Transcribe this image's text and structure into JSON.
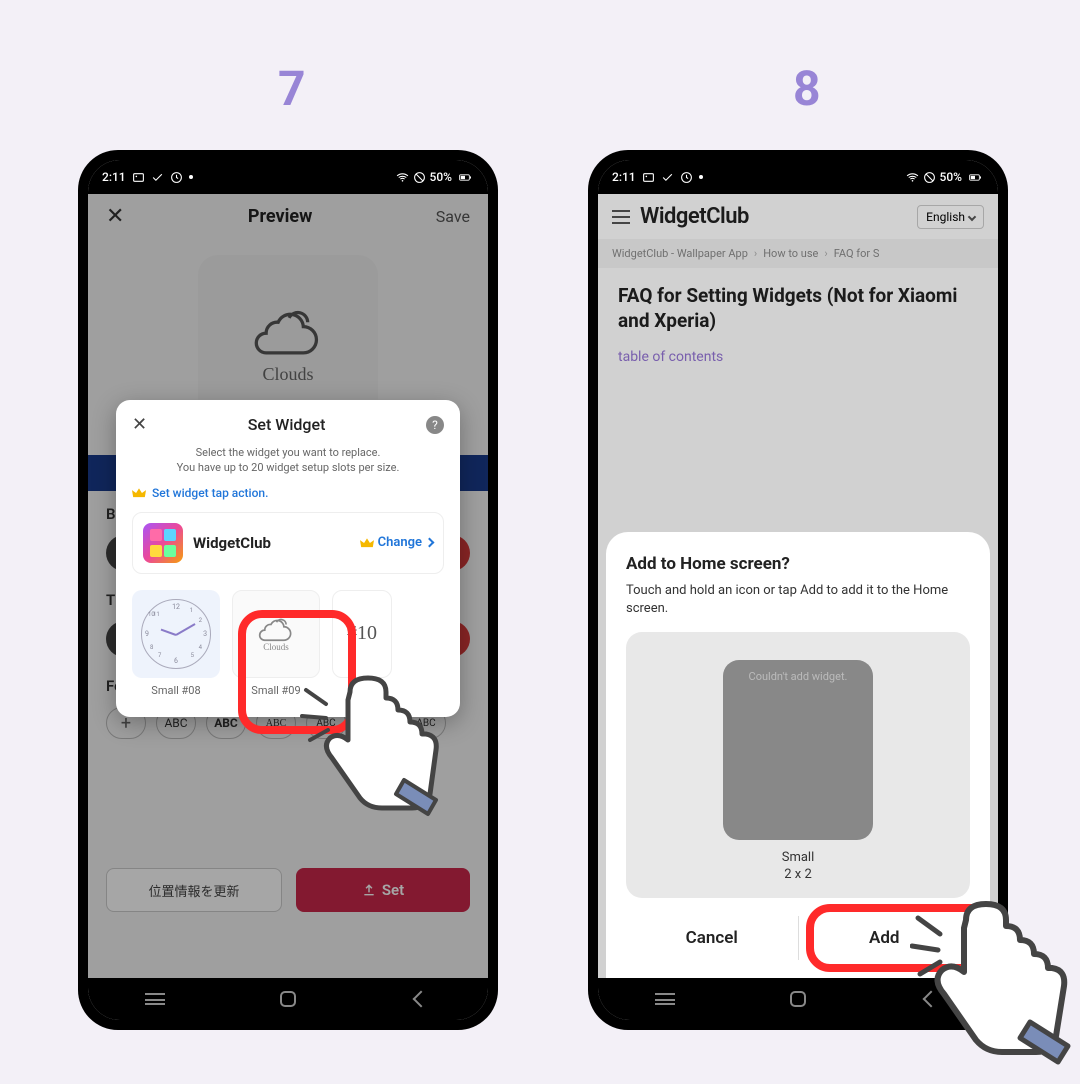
{
  "steps": {
    "left": "7",
    "right": "8"
  },
  "status_bar": {
    "time": "2:11",
    "battery": "50%"
  },
  "phone7": {
    "header": {
      "title": "Preview",
      "save": "Save"
    },
    "preview": {
      "weather": "Clouds"
    },
    "sections": {
      "ba": "Ba",
      "th": "Th",
      "font": "Font"
    },
    "font_chips": [
      "+",
      "ABC",
      "ABC",
      "ABC",
      "ABC",
      "ABC",
      "ABC"
    ],
    "buttons": {
      "location": "位置情報を更新",
      "set": "Set"
    },
    "dialog": {
      "title": "Set Widget",
      "help_char": "?",
      "subtitle_line1": "Select the widget you want to replace.",
      "subtitle_line2": "You have up to 20 widget setup slots per size.",
      "tap_action": "Set widget tap action.",
      "app_name": "WidgetClub",
      "change": "Change",
      "slots": {
        "s08": "Small #08",
        "s09": "Small #09",
        "s09_weather": "Clouds",
        "s10_num": "#10"
      }
    }
  },
  "phone8": {
    "logo": "WidgetClub",
    "language": "English",
    "breadcrumb": {
      "item1": "WidgetClub - Wallpaper App",
      "item2": "How to use",
      "item3": "FAQ for S"
    },
    "page_title": "FAQ for Setting Widgets (Not for Xiaomi and Xperia)",
    "toc": "table of contents",
    "sheet": {
      "title": "Add to Home screen?",
      "subtitle": "Touch and hold an icon or tap Add to add it to the Home screen.",
      "widget_error": "Couldn't add widget.",
      "size_name": "Small",
      "size_dim": "2 x 2",
      "cancel": "Cancel",
      "add": "Add"
    }
  }
}
